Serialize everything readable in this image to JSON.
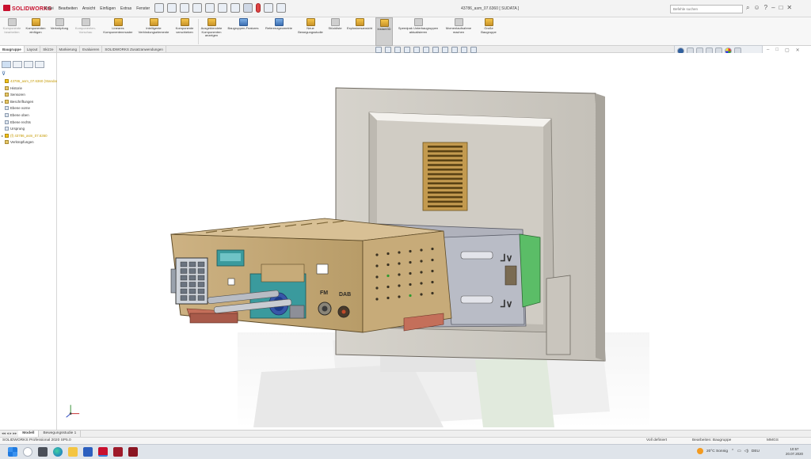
{
  "app": {
    "brand": "SOLIDWORKS",
    "file_title": "43786_asm_07.6360 [ SUDATA ]",
    "search_placeholder": "Befehle suchen"
  },
  "menu": [
    "Datei",
    "Bearbeiten",
    "Ansicht",
    "Einfügen",
    "Extras",
    "Fenster"
  ],
  "command_manager": [
    {
      "label": "Komponente bearbeiten",
      "state": "dim"
    },
    {
      "label": "Komponenten einfügen",
      "state": "normal"
    },
    {
      "label": "Verknüpfung",
      "state": "normal"
    },
    {
      "label": "Komponenten-Vorschau",
      "state": "dim"
    },
    {
      "label": "Lineares Komponentenmuster",
      "state": "normal"
    },
    {
      "label": "Intelligente Verbindungselemente",
      "state": "normal"
    },
    {
      "label": "Komponente verschieben",
      "state": "normal"
    },
    {
      "label": "Ausgeblendete Komponenten anzeigen",
      "state": "normal"
    },
    {
      "label": "Baugruppen-Features",
      "state": "normal"
    },
    {
      "label": "Referenzgeometrie",
      "state": "normal"
    },
    {
      "label": "Neue Bewegungsstudie",
      "state": "normal"
    },
    {
      "label": "Stückliste",
      "state": "normal"
    },
    {
      "label": "Explosionsansicht",
      "state": "normal"
    },
    {
      "label": "Instant3D",
      "state": "active"
    },
    {
      "label": "Speedpak Unterbaugruppen aktualisieren",
      "state": "normal"
    },
    {
      "label": "Momentaufnahme machen",
      "state": "normal"
    },
    {
      "label": "Große Baugruppe",
      "state": "normal"
    }
  ],
  "tabs": [
    "Baugruppe",
    "Layout",
    "Skizze",
    "Markierung",
    "Evaluieren",
    "SOLIDWORKS Zusatzanwendungen"
  ],
  "active_tab": "Baugruppe",
  "feature_tree": [
    {
      "label": "43786_asm_07.6360 (Standard)",
      "icon": "warn",
      "caret": "",
      "yellow": true
    },
    {
      "label": "Historie",
      "icon": "folder",
      "caret": "",
      "yellow": false
    },
    {
      "label": "Sensoren",
      "icon": "folder",
      "caret": "",
      "yellow": false
    },
    {
      "label": "Beschriftungen",
      "icon": "folder",
      "caret": "▸",
      "yellow": false
    },
    {
      "label": "Ebene vorne",
      "icon": "plane",
      "caret": "",
      "yellow": false
    },
    {
      "label": "Ebene oben",
      "icon": "plane",
      "caret": "",
      "yellow": false
    },
    {
      "label": "Ebene rechts",
      "icon": "plane",
      "caret": "",
      "yellow": false
    },
    {
      "label": "Ursprung",
      "icon": "plane",
      "caret": "",
      "yellow": false
    },
    {
      "label": "(f) 43786_asm_07.6360",
      "icon": "warn",
      "caret": "▸",
      "yellow": true
    },
    {
      "label": "Verknüpfungen",
      "icon": "folder",
      "caret": "",
      "yellow": false
    }
  ],
  "model_tabs": [
    "Modell",
    "Bewegungsstudie 1"
  ],
  "active_model_tab": "Modell",
  "status": {
    "left": "SOLIDWORKS Professional 2020 SP5.0",
    "defined": "Voll definiert",
    "editing": "Bearbeiten: Baugruppe",
    "units": "MMGS"
  },
  "model_labels": {
    "fm": "FM",
    "dab": "DAB"
  },
  "taskbar": {
    "weather": "20°C Sonnig",
    "lang": "DEU",
    "time": "10:57",
    "date": "20.07.2020"
  },
  "colors": {
    "brand_red": "#c8102e",
    "housing_tan": "#c7ab79",
    "frame_grey": "#d9d7d2",
    "pcb_green": "#5bbd67",
    "connector_teal": "#3a9a9d",
    "bracket_grey": "#b9bcc6"
  }
}
